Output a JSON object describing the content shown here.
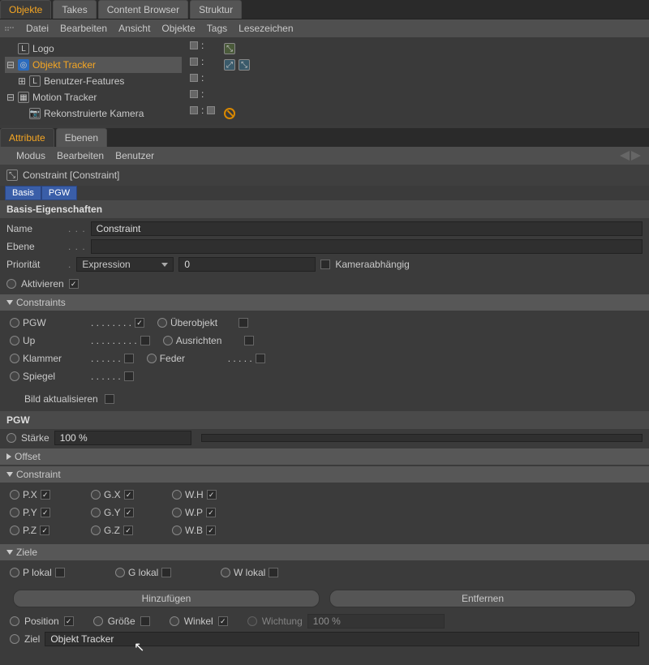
{
  "top_tabs": {
    "objekte": "Objekte",
    "takes": "Takes",
    "content_browser": "Content Browser",
    "struktur": "Struktur"
  },
  "menu": {
    "datei": "Datei",
    "bearbeiten": "Bearbeiten",
    "ansicht": "Ansicht",
    "objekte": "Objekte",
    "tags": "Tags",
    "lesezeichen": "Lesezeichen"
  },
  "tree": {
    "logo": "Logo",
    "objekt_tracker": "Objekt Tracker",
    "benutzer_features": "Benutzer-Features",
    "motion_tracker": "Motion Tracker",
    "rekonstruierte_kamera": "Rekonstruierte Kamera"
  },
  "attr_tabs": {
    "attribute": "Attribute",
    "ebenen": "Ebenen"
  },
  "attr_menu": {
    "modus": "Modus",
    "bearbeiten": "Bearbeiten",
    "benutzer": "Benutzer"
  },
  "attr_head": "Constraint [Constraint]",
  "subtabs": {
    "basis": "Basis",
    "pgw": "PGW"
  },
  "sections": {
    "basis_eigenschaften": "Basis-Eigenschaften",
    "pgw": "PGW",
    "offset": "Offset",
    "constraint": "Constraint",
    "constraints": "Constraints",
    "ziele": "Ziele"
  },
  "labels": {
    "name": "Name",
    "ebene": "Ebene",
    "prioritaet": "Priorität",
    "kameraabhaengig": "Kameraabhängig",
    "aktivieren": "Aktivieren",
    "pgw": "PGW",
    "ueberobjekt": "Überobjekt",
    "up": "Up",
    "ausrichten": "Ausrichten",
    "klammer": "Klammer",
    "feder": "Feder",
    "spiegel": "Spiegel",
    "bild_aktualisieren": "Bild aktualisieren",
    "staerke": "Stärke",
    "px": "P.X",
    "py": "P.Y",
    "pz": "P.Z",
    "gx": "G.X",
    "gy": "G.Y",
    "gz": "G.Z",
    "wh": "W.H",
    "wp": "W.P",
    "wb": "W.B",
    "p_lokal": "P lokal",
    "g_lokal": "G lokal",
    "w_lokal": "W lokal",
    "hinzufuegen": "Hinzufügen",
    "entfernen": "Entfernen",
    "position": "Position",
    "groesse": "Größe",
    "winkel": "Winkel",
    "wichtung": "Wichtung",
    "ziel": "Ziel"
  },
  "values": {
    "name": "Constraint",
    "ebene": "",
    "prioritaet_select": "Expression",
    "prioritaet_num": "0",
    "staerke": "100 %",
    "wichtung": "100 %",
    "ziel": "Objekt Tracker"
  },
  "checks": {
    "kameraabhaengig": false,
    "aktivieren": true,
    "pgw": true,
    "ueberobjekt": false,
    "up": false,
    "ausrichten": false,
    "klammer": false,
    "feder": false,
    "spiegel": false,
    "bild_aktualisieren": false,
    "px": true,
    "py": true,
    "pz": true,
    "gx": true,
    "gy": true,
    "gz": true,
    "wh": true,
    "wp": true,
    "wb": true,
    "p_lokal": false,
    "g_lokal": false,
    "w_lokal": false,
    "position": true,
    "groesse": false,
    "winkel": true
  }
}
